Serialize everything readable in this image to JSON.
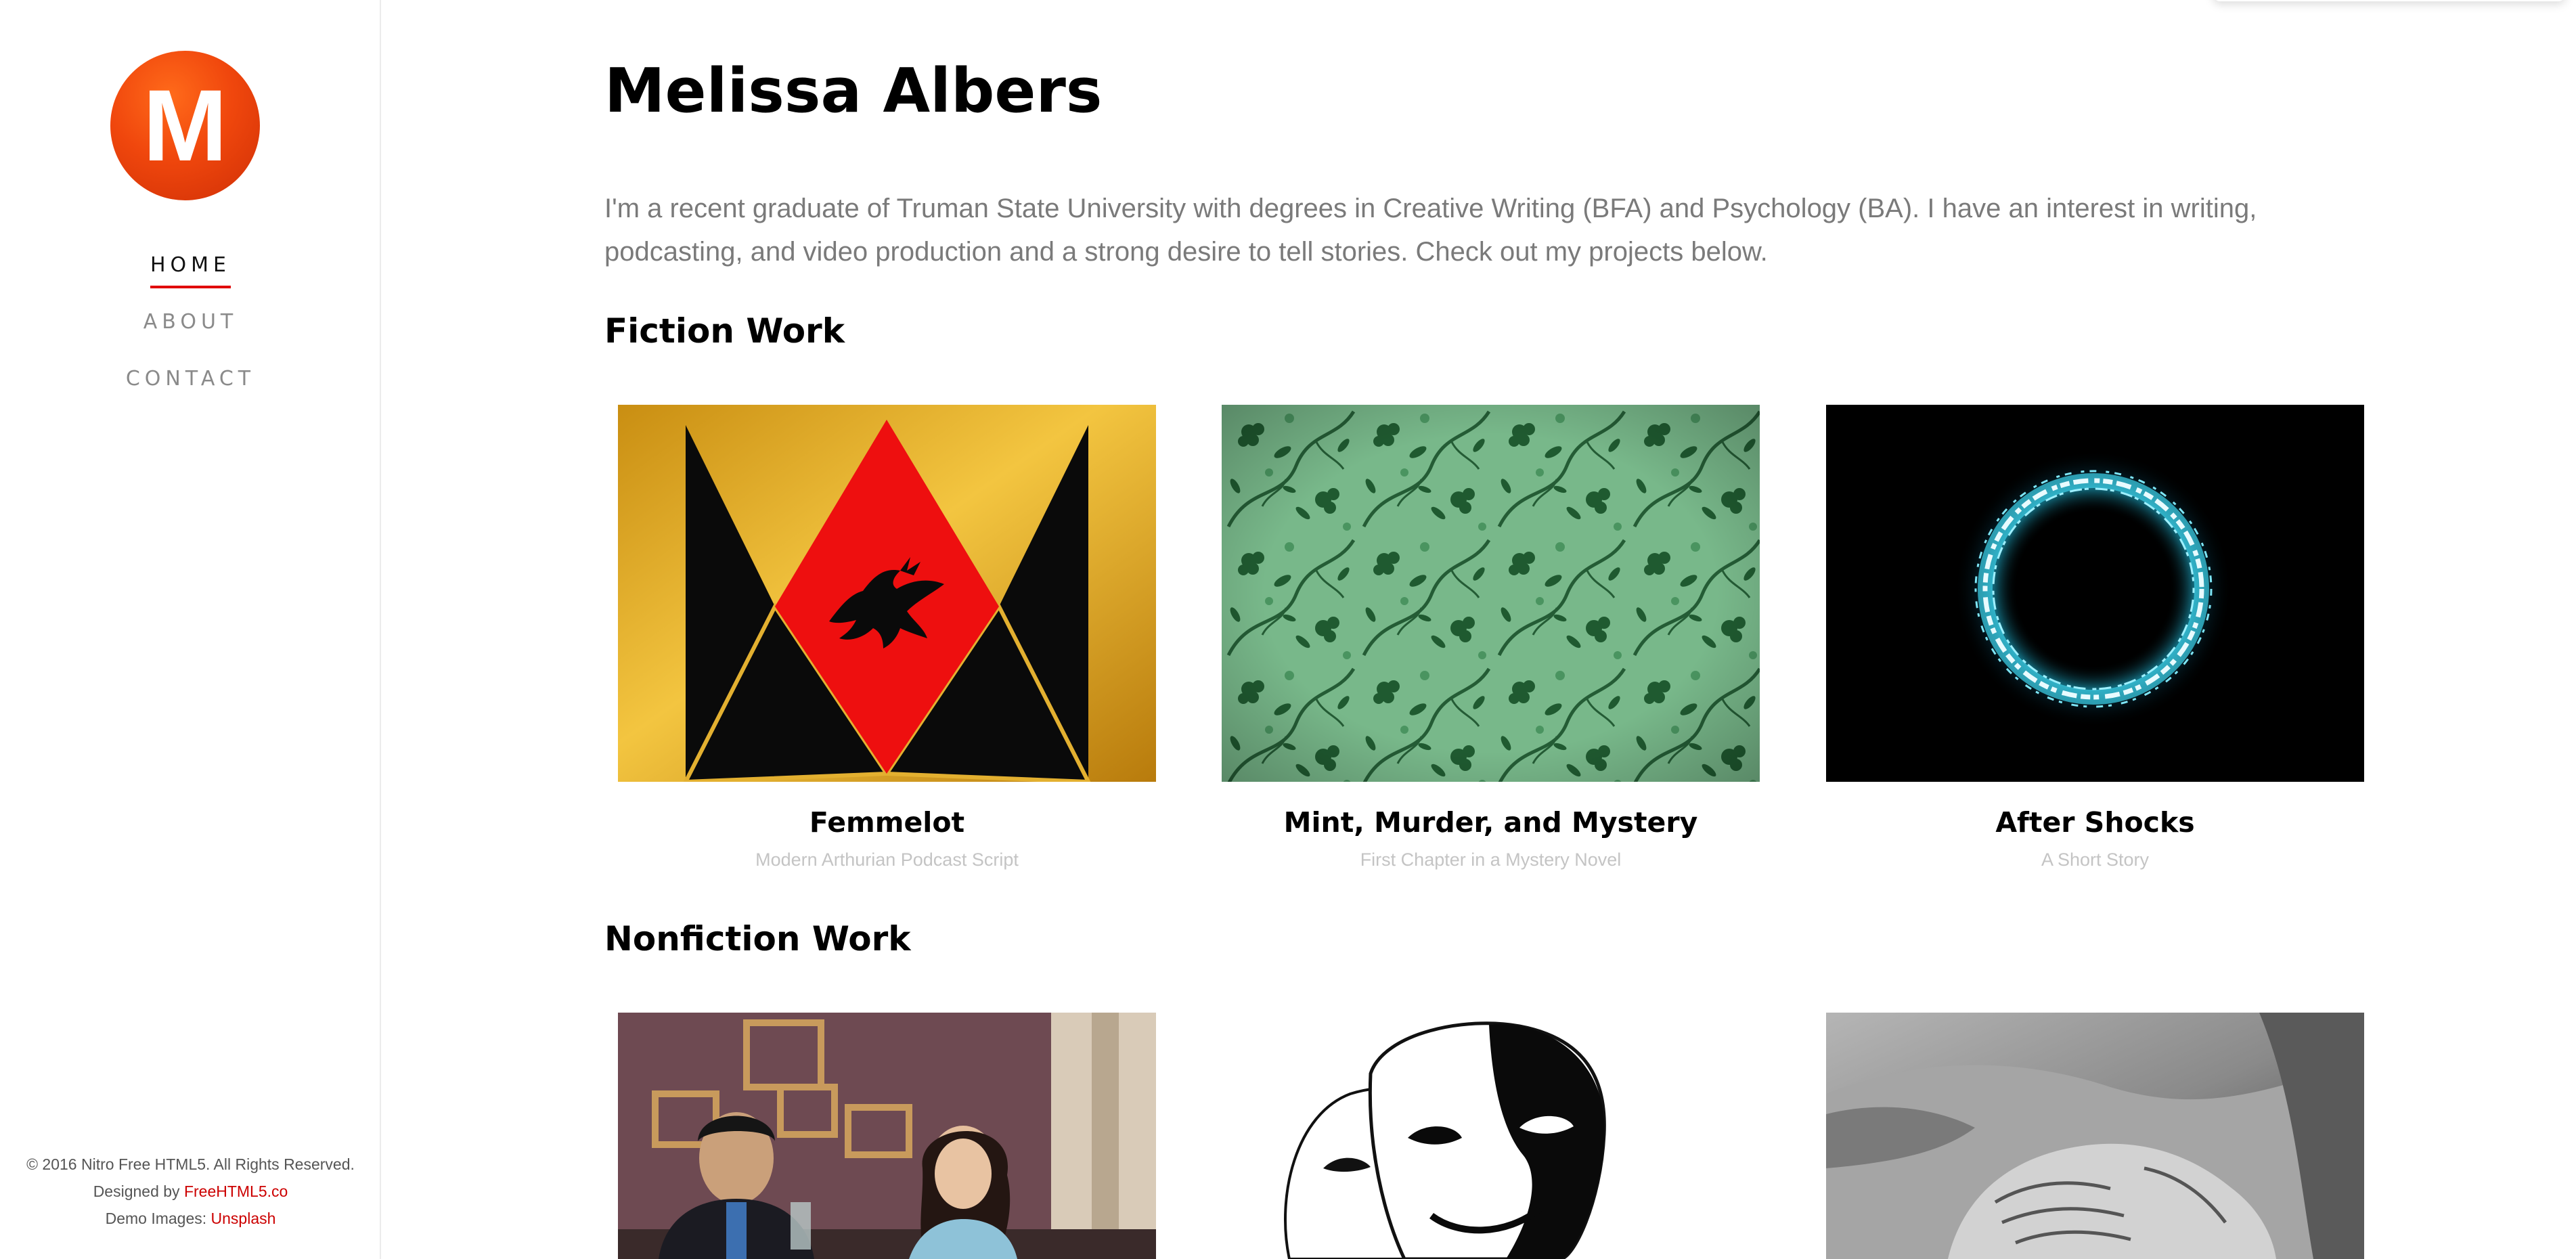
{
  "sidebar": {
    "logo_letter": "M",
    "nav": [
      {
        "label": "HOME",
        "active": true
      },
      {
        "label": "ABOUT",
        "active": false
      },
      {
        "label": "CONTACT",
        "active": false
      }
    ],
    "footer": {
      "copyright": "© 2016 Nitro Free HTML5. All Rights Reserved.",
      "designed_by_prefix": "Designed by ",
      "designed_by_link": "FreeHTML5.co",
      "demo_images_prefix": "Demo Images: ",
      "demo_images_link": "Unsplash"
    }
  },
  "main": {
    "title": "Melissa Albers",
    "intro": "I'm a recent graduate of Truman State University with degrees in Creative Writing (BFA) and Psychology (BA). I have an interest in writing, podcasting, and video production and a strong desire to tell stories. Check out my projects below.",
    "fiction_heading": "Fiction Work",
    "nonfiction_heading": "Nonfiction Work",
    "fiction": [
      {
        "title": "Femmelot",
        "subtitle": "Modern Arthurian Podcast Script",
        "image": "heraldic-dragon-image"
      },
      {
        "title": "Mint, Murder, and Mystery",
        "subtitle": "First Chapter in a Mystery Novel",
        "image": "green-floral-pattern-image"
      },
      {
        "title": "After Shocks",
        "subtitle": "A Short Story",
        "image": "electric-ring-image"
      }
    ],
    "nonfiction": [
      {
        "image": "couple-cafe-photo"
      },
      {
        "image": "theatre-masks-image"
      },
      {
        "image": "holding-hands-photo"
      }
    ]
  },
  "colors": {
    "accent": "#e00000",
    "logo": "#f0470d",
    "link": "#cc0000",
    "muted_text": "#7a7a7a",
    "subtitle_text": "#c4c4c4"
  }
}
